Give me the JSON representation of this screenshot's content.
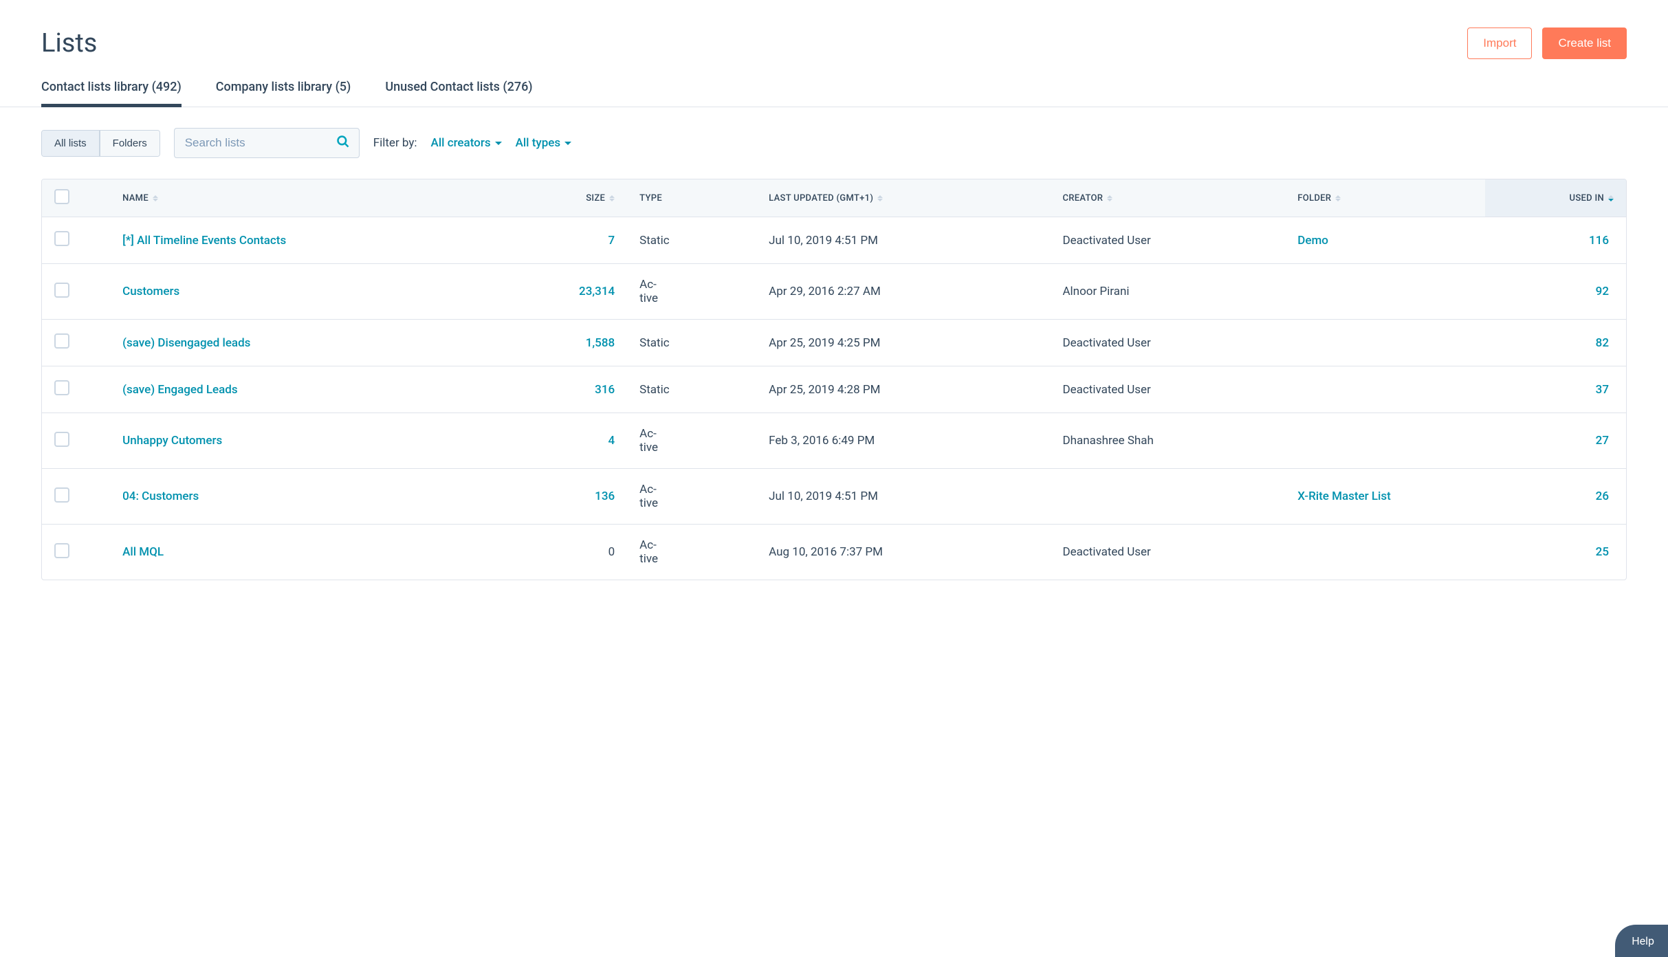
{
  "header": {
    "title": "Lists",
    "import_label": "Import",
    "create_label": "Create list"
  },
  "tabs": [
    {
      "label": "Contact lists library (492)",
      "active": true
    },
    {
      "label": "Company lists library (5)",
      "active": false
    },
    {
      "label": "Unused Contact lists (276)",
      "active": false
    }
  ],
  "toggle": {
    "all_lists": "All lists",
    "folders": "Folders"
  },
  "search": {
    "placeholder": "Search lists"
  },
  "filter": {
    "label": "Filter by:",
    "creators": "All creators",
    "types": "All types"
  },
  "columns": {
    "name": "NAME",
    "size": "SIZE",
    "type": "TYPE",
    "updated": "LAST UPDATED (GMT+1)",
    "creator": "CREATOR",
    "folder": "FOLDER",
    "usedin": "USED IN"
  },
  "rows": [
    {
      "name": "[*] All Timeline Events Contacts",
      "size": "7",
      "type": "Static",
      "updated": "Jul 10, 2019 4:51 PM",
      "creator": "Deactivated User",
      "folder": "Demo",
      "folder_link": true,
      "usedin": "116",
      "size_link": true
    },
    {
      "name": "Customers",
      "size": "23,314",
      "type": "Active",
      "updated": "Apr 29, 2016 2:27 AM",
      "creator": "Alnoor Pirani",
      "folder": "",
      "folder_link": false,
      "usedin": "92",
      "size_link": true
    },
    {
      "name": "(save) Disengaged leads",
      "size": "1,588",
      "type": "Static",
      "updated": "Apr 25, 2019 4:25 PM",
      "creator": "Deactivated User",
      "folder": "",
      "folder_link": false,
      "usedin": "82",
      "size_link": true
    },
    {
      "name": "(save) Engaged Leads",
      "size": "316",
      "type": "Static",
      "updated": "Apr 25, 2019 4:28 PM",
      "creator": "Deactivated User",
      "folder": "",
      "folder_link": false,
      "usedin": "37",
      "size_link": true
    },
    {
      "name": "Unhappy Cutomers",
      "size": "4",
      "type": "Active",
      "updated": "Feb 3, 2016 6:49 PM",
      "creator": "Dhanashree Shah",
      "folder": "",
      "folder_link": false,
      "usedin": "27",
      "size_link": true
    },
    {
      "name": "04: Customers",
      "size": "136",
      "type": "Active",
      "updated": "Jul 10, 2019 4:51 PM",
      "creator": "",
      "folder": "X-Rite Master List",
      "folder_link": true,
      "usedin": "26",
      "size_link": true
    },
    {
      "name": "All MQL",
      "size": "0",
      "type": "Active",
      "updated": "Aug 10, 2016 7:37 PM",
      "creator": "Deactivated User",
      "folder": "",
      "folder_link": false,
      "usedin": "25",
      "size_link": false
    }
  ],
  "help": "Help"
}
